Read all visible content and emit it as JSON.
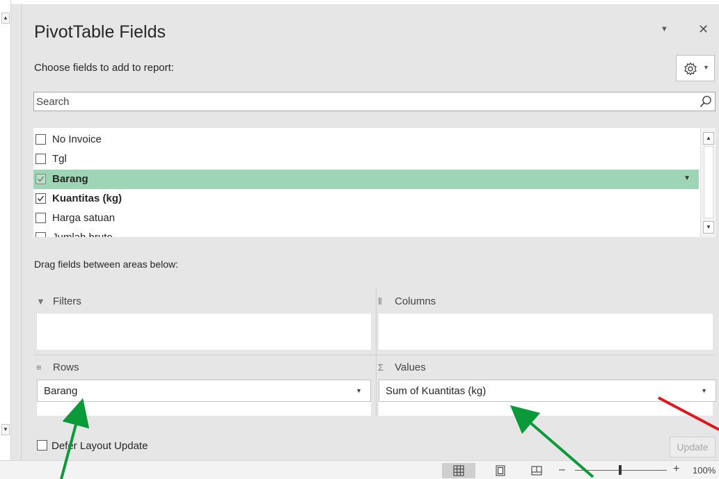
{
  "panel": {
    "title": "PivotTable Fields",
    "subtitle": "Choose fields to add to report:",
    "title_dropdown_icon": "▼",
    "close_icon": "✕"
  },
  "search": {
    "placeholder": "Search",
    "value": ""
  },
  "fields": [
    {
      "label": "No Invoice",
      "checked": false,
      "bold": false
    },
    {
      "label": "Tgl",
      "checked": false,
      "bold": false
    },
    {
      "label": "Barang",
      "checked": true,
      "bold": true,
      "selected": true
    },
    {
      "label": "Kuantitas (kg)",
      "checked": true,
      "bold": true
    },
    {
      "label": "Harga satuan",
      "checked": false,
      "bold": false
    },
    {
      "label": "Jumlah bruto",
      "checked": false,
      "bold": false
    }
  ],
  "areas": {
    "drag_label": "Drag fields between areas below:",
    "filters": {
      "label": "Filters"
    },
    "columns": {
      "label": "Columns"
    },
    "rows": {
      "label": "Rows",
      "field": "Barang"
    },
    "values": {
      "label": "Values",
      "field": "Sum of Kuantitas (kg)"
    }
  },
  "footer": {
    "defer_label": "Defer Layout Update",
    "defer_checked": false,
    "update_label": "Update"
  },
  "statusbar": {
    "zoom_level": "100%",
    "zoom_minus": "–",
    "zoom_plus": "+"
  },
  "colors": {
    "selected_row": "#9fd5b7",
    "arrow_green": "#0a9a3a",
    "arrow_red": "#e0161b"
  }
}
